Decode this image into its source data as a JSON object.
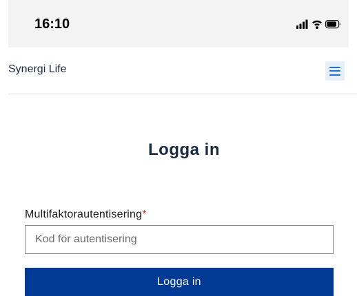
{
  "status_bar": {
    "time": "16:10",
    "icons": [
      "cellular-signal-icon",
      "wifi-icon",
      "battery-icon"
    ]
  },
  "header": {
    "brand": "Synergi Life",
    "menu_icon": "hamburger-menu-icon"
  },
  "main": {
    "title": "Logga in",
    "mfa": {
      "label": "Multifaktorautentisering",
      "required_marker": "*",
      "placeholder": "Kod för autentisering",
      "value": ""
    },
    "submit_label": "Logga in"
  },
  "colors": {
    "primary_button": "#003a94",
    "required": "#e0312f",
    "menu_accent": "#1f73d8",
    "menu_bg": "#e6f0fb",
    "title_text": "#1b2a44"
  }
}
